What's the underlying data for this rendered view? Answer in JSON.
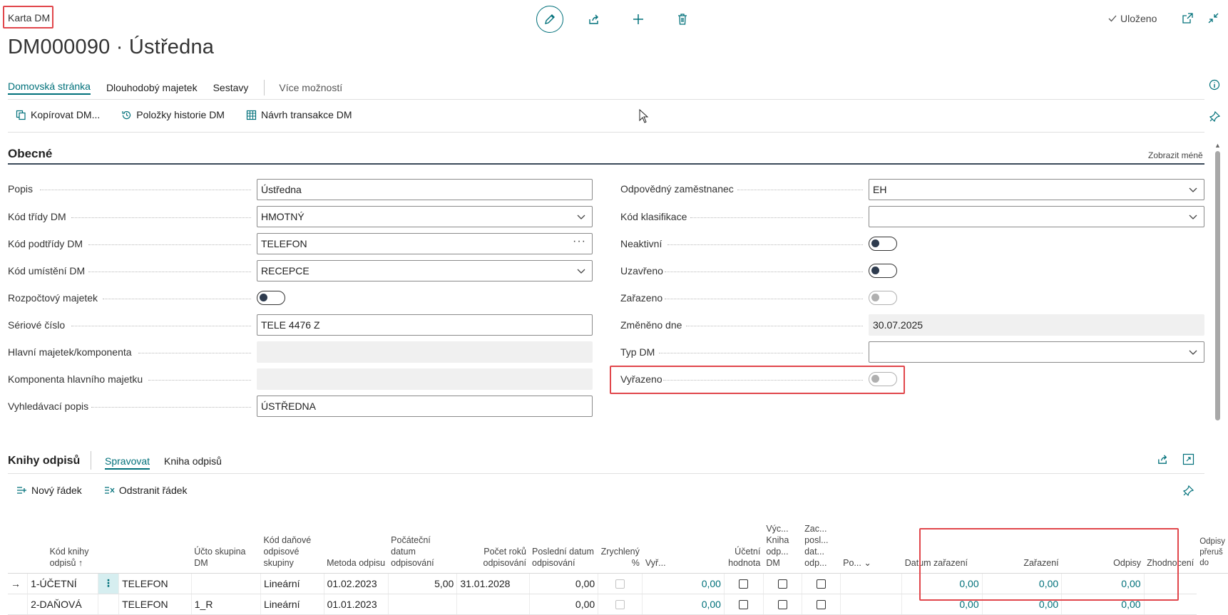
{
  "header": {
    "breadcrumb": "Karta DM",
    "title": "DM000090 · Ústředna",
    "saved_label": "Uloženo"
  },
  "tabs": [
    {
      "label": "Domovská stránka",
      "active": true
    },
    {
      "label": "Dlouhodobý majetek"
    },
    {
      "label": "Sestavy"
    }
  ],
  "more_label": "Více možností",
  "actions": {
    "copy": "Kopírovat DM...",
    "history": "Položky historie DM",
    "proposal": "Návrh transakce DM"
  },
  "general": {
    "title": "Obecné",
    "show_less": "Zobrazit méně",
    "left": {
      "popis": {
        "label": "Popis",
        "value": "Ústředna"
      },
      "trida": {
        "label": "Kód třídy DM",
        "value": "HMOTNÝ"
      },
      "podtrida": {
        "label": "Kód podtřídy DM",
        "value": "TELEFON"
      },
      "umisteni": {
        "label": "Kód umístění DM",
        "value": "RECEPCE"
      },
      "rozpoctovy": {
        "label": "Rozpočtový majetek"
      },
      "seriove": {
        "label": "Sériové číslo",
        "value": "TELE 4476 Z"
      },
      "hlavni": {
        "label": "Hlavní majetek/komponenta",
        "value": ""
      },
      "komponenta": {
        "label": "Komponenta hlavního majetku",
        "value": ""
      },
      "vyhledavaci": {
        "label": "Vyhledávací popis",
        "value": "ÚSTŘEDNA"
      }
    },
    "right": {
      "zamestnanec": {
        "label": "Odpovědný zaměstnanec",
        "value": "EH"
      },
      "klasifikace": {
        "label": "Kód klasifikace",
        "value": ""
      },
      "neaktivni": {
        "label": "Neaktivní"
      },
      "uzavreno": {
        "label": "Uzavřeno"
      },
      "zarazeno": {
        "label": "Zařazeno"
      },
      "zmeneno": {
        "label": "Změněno dne",
        "value": "30.07.2025"
      },
      "typ": {
        "label": "Typ DM",
        "value": ""
      },
      "vyrazeno": {
        "label": "Vyřazeno"
      }
    }
  },
  "books": {
    "title": "Knihy odpisů",
    "tab_manage": "Spravovat",
    "tab_book": "Kniha odpisů",
    "new_row": "Nový řádek",
    "delete_row": "Odstranit řádek",
    "columns": {
      "kod": "Kód knihy odpisů ↑",
      "ucto": "Účto skupina DM",
      "dan": "Kód daňové odpisové skupiny",
      "metoda": "Metoda odpisu",
      "pocatecni": "Počáteční datum odpisování",
      "pocet": "Počet roků odpisování",
      "posledni": "Poslední datum odpisování",
      "zrychleny": "Zrychlený %",
      "vyr": "Vyř...",
      "ucetni": "Účetní hodnota",
      "vych": "Výc... Kniha odp... DM",
      "zac": "Zac... posl... dat... odp...",
      "po": "Po...",
      "datum": "Datum zařazení",
      "zarazeni": "Zařazení",
      "odpisy": "Odpisy",
      "zhodnoceni": "Zhodnocení",
      "prerus": "Odpisy přeruš do"
    },
    "rows": [
      {
        "kod": "1-ÚČETNÍ",
        "ucto": "TELEFON",
        "dan": "",
        "metoda": "Lineární",
        "pocatecni": "01.02.2023",
        "pocet": "5,00",
        "posledni": "31.01.2028",
        "zrychleny": "0,00",
        "ucetni": "0,00",
        "zarazeni": "0,00",
        "odpisy": "0,00",
        "zhodnoceni": "0,00"
      },
      {
        "kod": "2-DAŇOVÁ",
        "ucto": "TELEFON",
        "dan": "1_R",
        "metoda": "Lineární",
        "pocatecni": "01.01.2023",
        "pocet": "",
        "posledni": "",
        "zrychleny": "0,00",
        "ucetni": "0,00",
        "zarazeni": "0,00",
        "odpisy": "0,00",
        "zhodnoceni": "0,00"
      }
    ]
  },
  "colors": {
    "accent": "#00707a",
    "highlight": "#e1464b"
  }
}
